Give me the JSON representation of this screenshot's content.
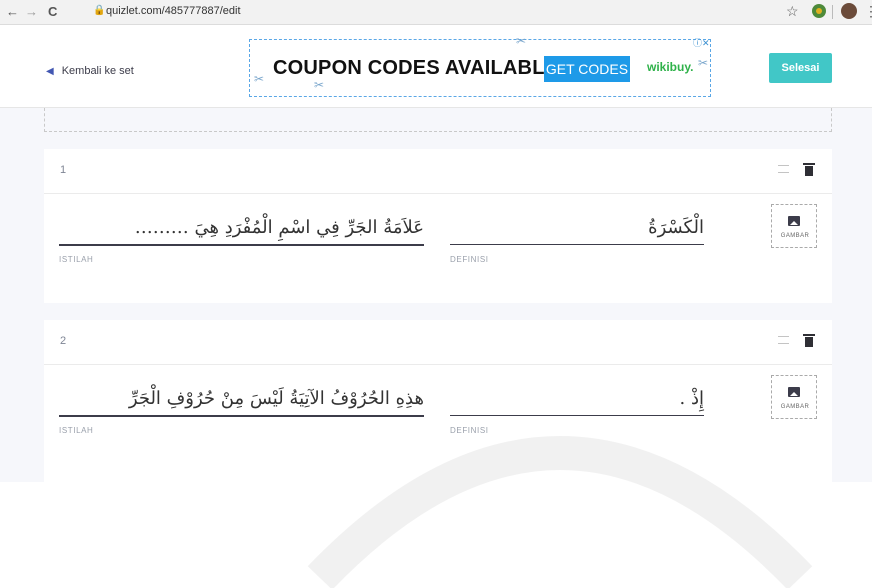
{
  "browser": {
    "url": "quizlet.com/485777887/edit",
    "back_glyph": "←",
    "forward_glyph": "→",
    "reload_glyph": "C",
    "star_glyph": "☆",
    "menu_glyph": "⋮"
  },
  "header": {
    "back_label": "Kembali ke set",
    "done_label": "Selesai"
  },
  "ad": {
    "headline": "COUPON CODES AVAILABLE",
    "button_label": "GET CODES",
    "brand": "wikibuy.",
    "close_label": "ⓘ✕"
  },
  "cards": [
    {
      "number": "1",
      "term": "عَلاَمَةُ الجَرِّ فِي اسْمِ الْمُفْرَدِ هِيَ ………",
      "term_label": "ISTILAH",
      "definition": "الْكَسْرَةُ",
      "definition_label": "DEFINISI",
      "image_label": "GAMBAR"
    },
    {
      "number": "2",
      "term": "هذِهِ الحُرُوْفُ الآتِيَةُ لَيْسَ مِنْ حُرُوْفِ الْجَرِّ",
      "term_label": "ISTILAH",
      "definition": "إِذْ .",
      "definition_label": "DEFINISI",
      "image_label": "GAMBAR"
    }
  ],
  "colors": {
    "accent": "#41c7c7",
    "link": "#4257b2",
    "ad_blue": "#1e9ae8",
    "ad_green": "#2fb24a"
  }
}
